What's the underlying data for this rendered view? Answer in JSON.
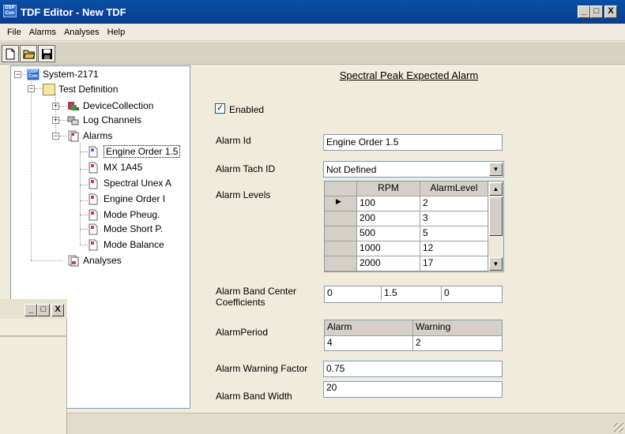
{
  "window": {
    "title": "TDF Editor - New TDF",
    "app_icon_text": "DSP Con",
    "minimize": "_",
    "maximize": "□",
    "close": "X"
  },
  "menu": [
    "File",
    "Alarms",
    "Analyses",
    "Help"
  ],
  "toolbar": {
    "buttons": [
      "new-file-icon",
      "open-folder-icon",
      "save-disk-icon"
    ]
  },
  "tree": {
    "root": "System-2171",
    "test_definition": "Test Definition",
    "device_collection": "DeviceCollection",
    "log_channels": "Log Channels",
    "alarms": "Alarms",
    "alarm_items": [
      "Engine Order 1.5",
      "MX 1A45",
      "Spectral Unex A",
      "Engine Order I",
      "Mode Pheug.",
      "Mode Short P.",
      "Mode Balance"
    ],
    "alarm_icon_letters": [
      "E",
      "T",
      "E",
      "M",
      "M",
      "M",
      "M"
    ],
    "analyses": "Analyses"
  },
  "form": {
    "heading": "Spectral Peak Expected Alarm",
    "enabled_label": "Enabled",
    "enabled_checked": true,
    "enabled_mark": "✓",
    "alarm_id_label": "Alarm Id",
    "alarm_id_value": "Engine Order 1.5",
    "alarm_tach_label": "Alarm Tach ID",
    "alarm_tach_value": "Not Defined",
    "alarm_levels_label": "Alarm Levels",
    "levels_columns": [
      "RPM",
      "AlarmLevel"
    ],
    "levels_rows": [
      [
        "100",
        "2"
      ],
      [
        "200",
        "3"
      ],
      [
        "500",
        "5"
      ],
      [
        "1000",
        "12"
      ],
      [
        "2000",
        "17"
      ]
    ],
    "current_row_marker": "▶",
    "band_center_label": "Alarm Band Center Coefficients",
    "band_center_values": [
      "0",
      "1.5",
      "0"
    ],
    "period_label": "AlarmPeriod",
    "period_columns": [
      "Alarm",
      "Warning"
    ],
    "period_values": [
      "4",
      "2"
    ],
    "warning_factor_label": "Alarm Warning Factor",
    "warning_factor_value": "0.75",
    "band_width_label": "Alarm Band Width",
    "band_width_value": "20"
  },
  "second_window": {
    "minimize": "_",
    "maximize": "□",
    "close": "X"
  }
}
